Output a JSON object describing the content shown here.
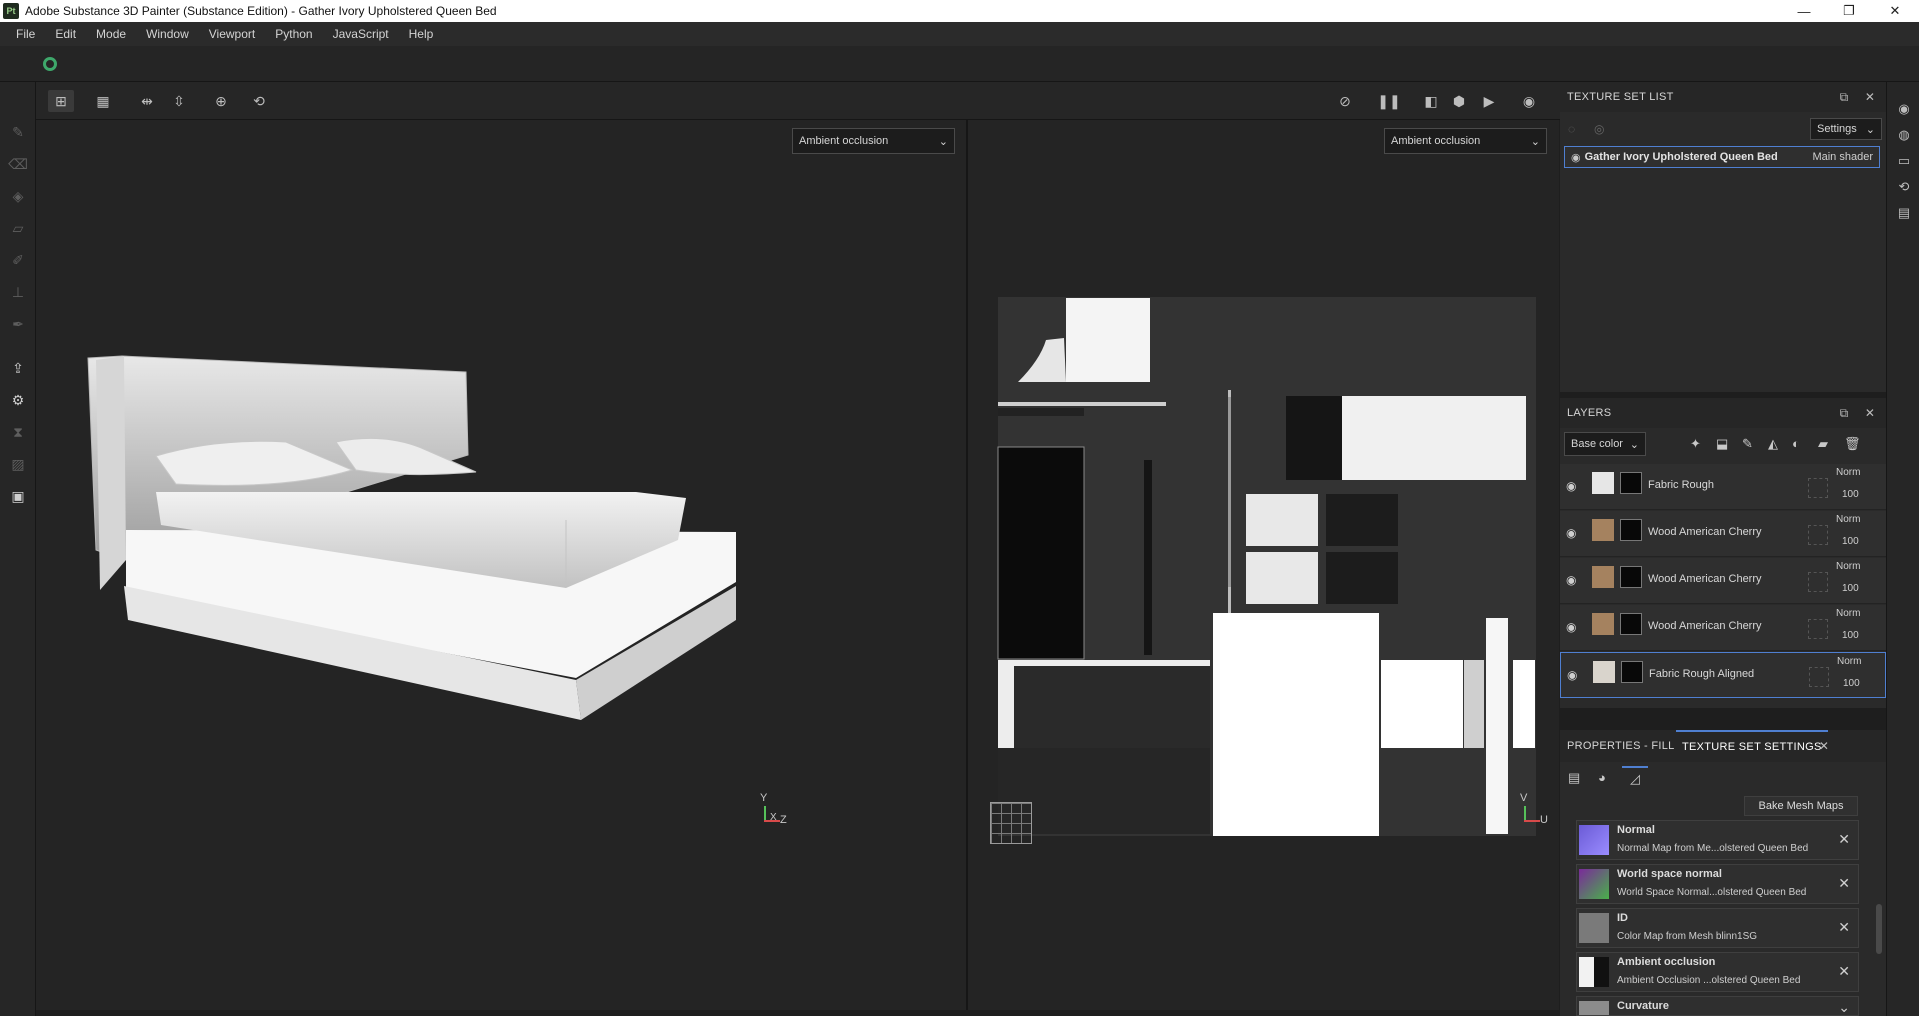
{
  "window": {
    "app_icon": "Pt",
    "title": "Adobe Substance 3D Painter (Substance Edition) - Gather Ivory Upholstered Queen Bed",
    "minimize": "—",
    "maximize": "❐",
    "close": "✕"
  },
  "menu": [
    "File",
    "Edit",
    "Mode",
    "Window",
    "Viewport",
    "Python",
    "JavaScript",
    "Help"
  ],
  "viewport": {
    "left_channel": "Ambient occlusion",
    "right_channel": "Ambient occlusion",
    "axis_3d_y": "Y",
    "axis_3d_x": "X",
    "axis_3d_z": "Z",
    "axis_2d_v": "V",
    "axis_2d_u": "U"
  },
  "texture_set_list": {
    "title": "TEXTURE SET LIST",
    "settings_label": "Settings",
    "item_name": "Gather Ivory Upholstered Queen Bed",
    "item_shader": "Main shader"
  },
  "layers": {
    "title": "LAYERS",
    "channel": "Base color",
    "items": [
      {
        "name": "Fabric Rough",
        "blend": "Norm",
        "opacity": "100"
      },
      {
        "name": "Wood American Cherry",
        "blend": "Norm",
        "opacity": "100"
      },
      {
        "name": "Wood American Cherry",
        "blend": "Norm",
        "opacity": "100"
      },
      {
        "name": "Wood American Cherry",
        "blend": "Norm",
        "opacity": "100"
      },
      {
        "name": "Fabric Rough Aligned",
        "blend": "Norm",
        "opacity": "100"
      }
    ]
  },
  "properties": {
    "tab_fill": "PROPERTIES - FILL",
    "tab_tss": "TEXTURE SET SETTINGS",
    "bake_button": "Bake Mesh Maps",
    "maps": [
      {
        "title": "Normal",
        "sub": "Normal Map from Me...olstered Queen Bed"
      },
      {
        "title": "World space normal",
        "sub": "World Space Normal...olstered Queen Bed"
      },
      {
        "title": "ID",
        "sub": "Color Map from Mesh blinn1SG"
      },
      {
        "title": "Ambient occlusion",
        "sub": "Ambient Occlusion ...olstered Queen Bed"
      },
      {
        "title": "Curvature",
        "sub": ""
      }
    ]
  },
  "colors": {
    "accent": "#4f7fd1",
    "logo": "#3ea86b",
    "background": "#1e1e1e"
  }
}
